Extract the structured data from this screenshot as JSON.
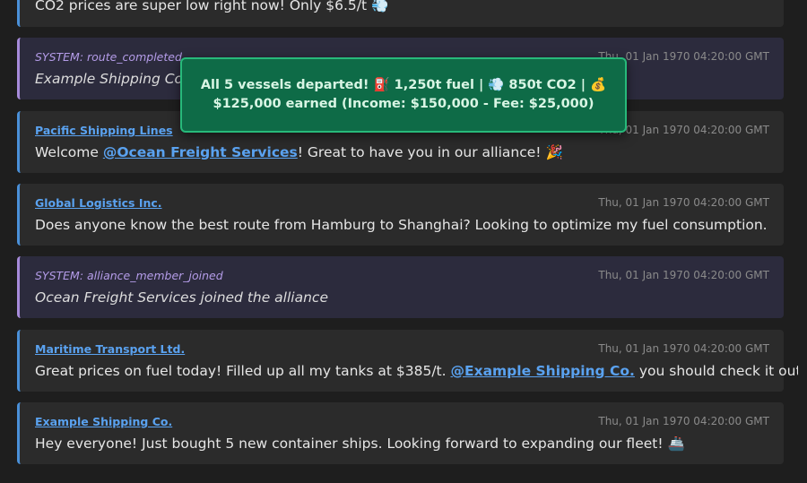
{
  "messages": [
    {
      "type": "partial",
      "body": "CO2 prices are super low right now! Only $6.5/t 💨"
    },
    {
      "type": "system",
      "sender": "SYSTEM: route_completed",
      "time": "Thu, 01 Jan 1970 04:20:00 GMT",
      "body": "Example Shipping Co. c"
    },
    {
      "type": "user",
      "sender": "Pacific Shipping Lines",
      "time": "Thu, 01 Jan 1970 04:20:00 GMT",
      "body_pre": "Welcome ",
      "mention": "@Ocean Freight Services",
      "body_post": "! Great to have you in our alliance! 🎉"
    },
    {
      "type": "user",
      "sender": "Global Logistics Inc.",
      "time": "Thu, 01 Jan 1970 04:20:00 GMT",
      "body": "Does anyone know the best route from Hamburg to Shanghai? Looking to optimize my fuel consumption."
    },
    {
      "type": "system",
      "sender": "SYSTEM: alliance_member_joined",
      "time": "Thu, 01 Jan 1970 04:20:00 GMT",
      "body": "Ocean Freight Services joined the alliance"
    },
    {
      "type": "user",
      "sender": "Maritime Transport Ltd.",
      "time": "Thu, 01 Jan 1970 04:20:00 GMT",
      "body_pre": "Great prices on fuel today! Filled up all my tanks at $385/t. ",
      "mention": "@Example Shipping Co.",
      "body_post": " you should check it out!"
    },
    {
      "type": "user",
      "sender": "Example Shipping Co.",
      "time": "Thu, 01 Jan 1970 04:20:00 GMT",
      "body": "Hey everyone! Just bought 5 new container ships. Looking forward to expanding our fleet! 🚢"
    }
  ],
  "toast": {
    "line1": "All 5 vessels departed! ⛽ 1,250t fuel | 💨 850t CO2 | 💰",
    "line2": "$125,000 earned (Income: $150,000 - Fee: $25,000)"
  },
  "colors": {
    "background": "#1e1e1e",
    "message_bg": "#2b2b2b",
    "system_bg": "#2c2b3d",
    "user_accent": "#4a90d9",
    "system_accent": "#a78bda",
    "link": "#5aa2f0",
    "toast_bg": "#0e6b47",
    "toast_border": "#27b97a"
  }
}
